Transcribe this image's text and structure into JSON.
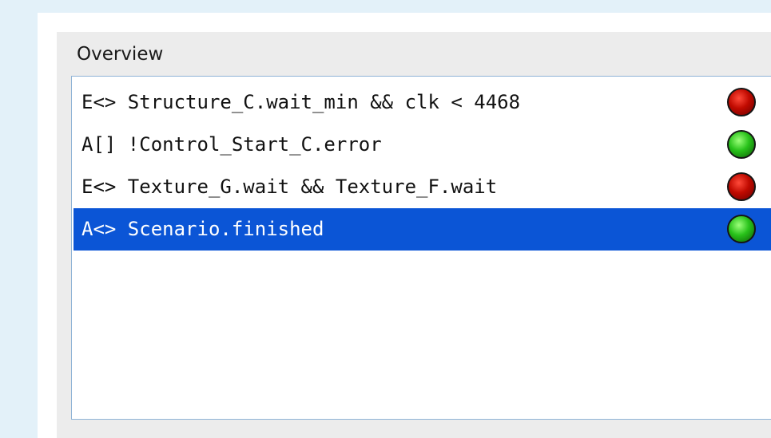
{
  "panel": {
    "title": "Overview"
  },
  "queries": [
    {
      "text": "E<> Structure_C.wait_min && clk < 4468",
      "status": "red-light-icon",
      "color": "#c00a00"
    },
    {
      "text": "A[] !Control_Start_C.error",
      "status": "green-light-icon",
      "color": "#28c21a"
    },
    {
      "text": "E<> Texture_G.wait && Texture_F.wait",
      "status": "red-light-icon",
      "color": "#c00a00"
    },
    {
      "text": "A<> Scenario.finished",
      "status": "green-light-icon",
      "color": "#28c21a",
      "selected": true
    }
  ],
  "colors": {
    "selection": "#0b55d6",
    "background": "#e3f1f9"
  }
}
